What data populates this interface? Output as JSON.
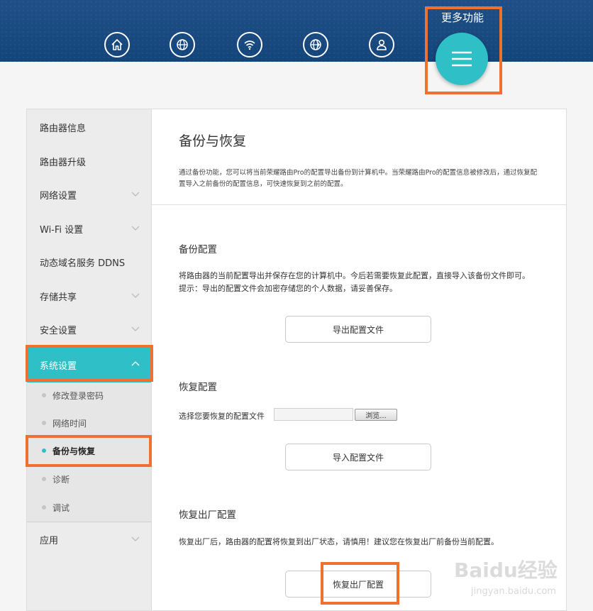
{
  "header": {
    "nav_icons": [
      "home-icon",
      "globe-icon",
      "wifi-icon",
      "globe-settings-icon",
      "user-icon"
    ],
    "more_label": "更多功能",
    "more_icon": "menu-icon"
  },
  "sidebar": {
    "items": [
      {
        "label": "路由器信息"
      },
      {
        "label": "路由器升级"
      },
      {
        "label": "网络设置"
      },
      {
        "label": "Wi-Fi 设置"
      },
      {
        "label": "动态域名服务 DDNS"
      },
      {
        "label": "存储共享"
      },
      {
        "label": "安全设置"
      },
      {
        "label": "系统设置"
      },
      {
        "label": "应用"
      }
    ],
    "sub_items": [
      {
        "label": "修改登录密码"
      },
      {
        "label": "网络时间"
      },
      {
        "label": "备份与恢复"
      },
      {
        "label": "诊断"
      },
      {
        "label": "调试"
      }
    ]
  },
  "main": {
    "title": "备份与恢复",
    "description": "通过备份功能，您可以将当前荣耀路由Pro的配置导出备份到计算机中。当荣耀路由Pro的配置信息被修改后，通过恢复配置导入之前备份的配置信息，可快速恢复到之前的配置。",
    "backup": {
      "title": "备份配置",
      "text1": "将路由器的当前配置导出并保存在您的计算机中。今后若需要恢复此配置，直接导入该备份文件即可。",
      "text2": "提示：导出的配置文件会加密存储您的个人数据，请妥善保存。",
      "button": "导出配置文件"
    },
    "restore": {
      "title": "恢复配置",
      "file_label": "选择您要恢复的配置文件",
      "browse": "浏览...",
      "button": "导入配置文件"
    },
    "factory": {
      "title": "恢复出厂配置",
      "text": "恢复出厂后，路由器的配置将恢复到出厂状态，请慎用！建议您在恢复出厂前备份当前配置。",
      "button": "恢复出厂配置"
    }
  },
  "watermark": {
    "logo": "Baidu经验",
    "url": "jingyan.baidu.com"
  },
  "colors": {
    "header": "#1a4a80",
    "accent": "#2ec0c6",
    "highlight": "#f07030"
  }
}
